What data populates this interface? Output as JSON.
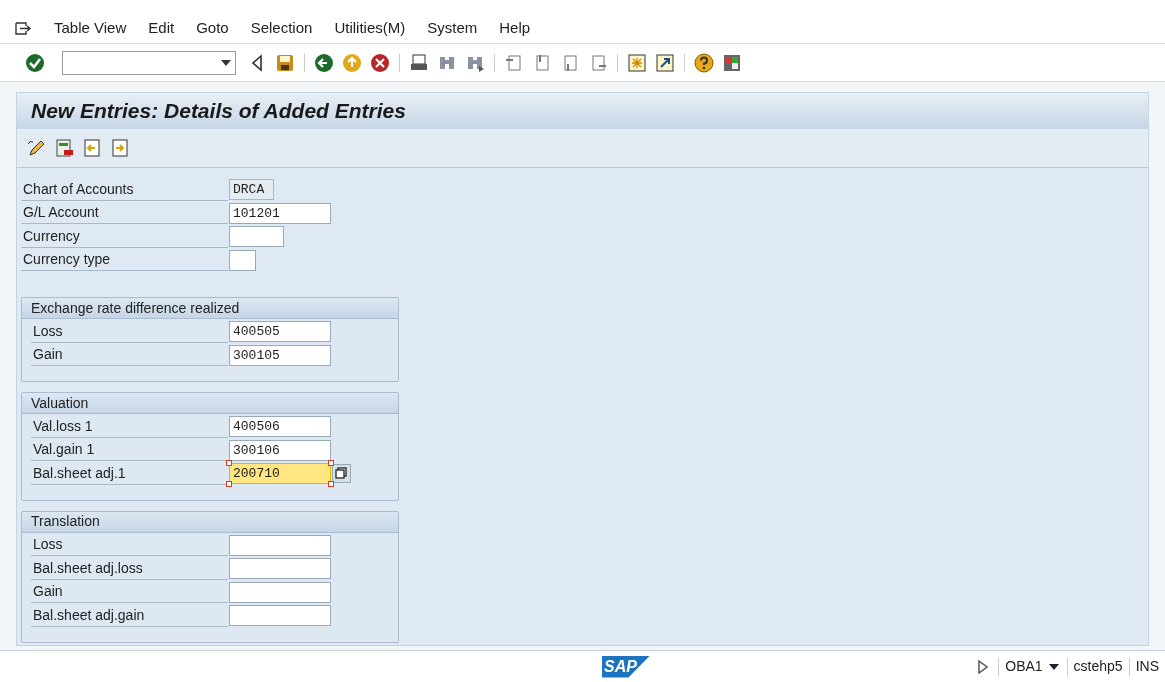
{
  "menu_bar": [
    "Table View",
    "Edit",
    "Goto",
    "Selection",
    "Utilities(M)",
    "System",
    "Help"
  ],
  "screen_title": "New Entries: Details of Added Entries",
  "header_fields": [
    {
      "label": "Chart of Accounts",
      "value": "DRCA",
      "read_only": true,
      "focused": false
    },
    {
      "label": "G/L Account",
      "value": "101201",
      "read_only": false,
      "focused": false
    },
    {
      "label": "Currency",
      "read_only": false,
      "focused": false
    },
    {
      "label": "Currency type",
      "read_only": false,
      "focused": false
    }
  ],
  "groups": [
    {
      "title": "Exchange rate difference realized",
      "fields": [
        {
          "label": "Loss",
          "value": "400505",
          "read_only": false,
          "focused": false
        },
        {
          "label": "Gain",
          "value": "300105",
          "read_only": false,
          "focused": false
        }
      ]
    },
    {
      "title": "Valuation",
      "fields": [
        {
          "label": "Val.loss 1",
          "value": "400506",
          "read_only": false,
          "focused": false
        },
        {
          "label": "Val.gain 1",
          "value": "300106",
          "read_only": false,
          "focused": false
        },
        {
          "label": "Bal.sheet adj.1",
          "value": "200710",
          "read_only": false,
          "focused": true
        }
      ]
    },
    {
      "title": "Translation",
      "fields": [
        {
          "label": "Loss",
          "read_only": false,
          "focused": false
        },
        {
          "label": "Bal.sheet adj.loss",
          "read_only": false,
          "focused": false
        },
        {
          "label": "Gain",
          "read_only": false,
          "focused": false
        },
        {
          "label": "Bal.sheet adj.gain",
          "read_only": false,
          "focused": false
        }
      ]
    }
  ],
  "status_bar": {
    "logo": "SAP",
    "transaction": "OBA1",
    "server": "cstehp5",
    "mode": "INS"
  }
}
